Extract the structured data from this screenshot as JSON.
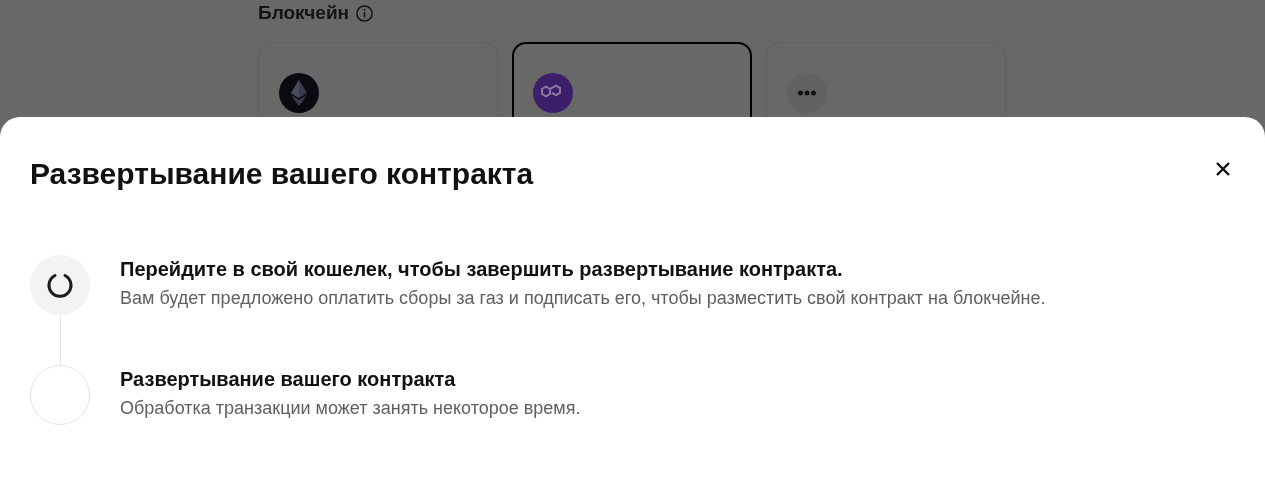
{
  "background_page": {
    "section_title": "Блокчейн",
    "chains": [
      {
        "kind": "ethereum",
        "selected": false
      },
      {
        "kind": "polygon",
        "selected": true
      },
      {
        "kind": "more",
        "selected": false
      }
    ]
  },
  "dialog": {
    "title": "Развертывание вашего контракта",
    "steps": [
      {
        "kind": "loading",
        "title": "Перейдите в свой кошелек, чтобы завершить развертывание контракта.",
        "description": "Вам будет предложено оплатить сборы за газ и подписать его, чтобы разместить свой контракт на блокчейне."
      },
      {
        "kind": "pending",
        "title": "Развертывание вашего контракта",
        "description": "Обработка транзакции может занять некоторое время."
      }
    ]
  }
}
